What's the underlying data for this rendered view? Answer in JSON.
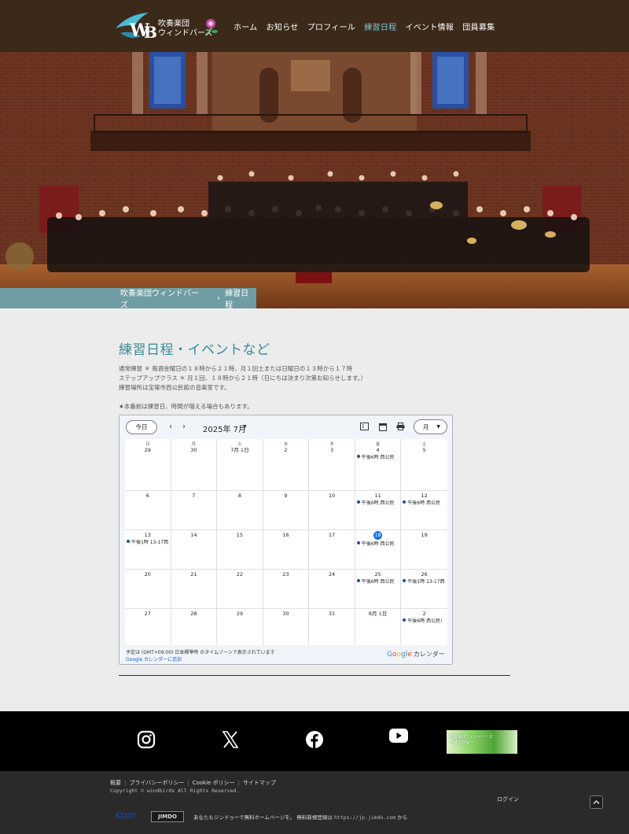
{
  "header": {
    "logo_line1": "吹奏楽団",
    "logo_line2": "ウィンドバーズ",
    "nav": [
      "ホーム",
      "お知らせ",
      "プロフィール",
      "練習日程",
      "イベント情報",
      "団員募集"
    ],
    "active_nav": "練習日程"
  },
  "breadcrumb": {
    "home": "吹奏楽団ウィンドバーズ",
    "separator": "›",
    "current": "練習日程"
  },
  "main": {
    "title": "練習日程・イベントなど",
    "lines": [
      "通常練習 ＊ 毎週金曜日の１８時から２１時、月１回土または日曜日の１３時から１７時",
      "ステップアップクラス ＊ 月１回、１８時から２１時（日にちは決まり次第お知らせします。）",
      "練習場所は宝塚市西公民館の音楽室です。"
    ],
    "note": "★本番前は練習日、時間が増える場合もあります。"
  },
  "calendar": {
    "today_button": "今日",
    "prev": "‹",
    "next": "›",
    "month_label": "2025年 7月",
    "view_button": "月",
    "weekdays": [
      "日",
      "月",
      "火",
      "水",
      "木",
      "金",
      "土"
    ],
    "weeks": [
      [
        {
          "d": "29"
        },
        {
          "d": "30"
        },
        {
          "d": "7月 1日"
        },
        {
          "d": "2"
        },
        {
          "d": "3"
        },
        {
          "d": "4",
          "ev": "午後6時 西公民"
        },
        {
          "d": "5"
        }
      ],
      [
        {
          "d": "6"
        },
        {
          "d": "7"
        },
        {
          "d": "8"
        },
        {
          "d": "9"
        },
        {
          "d": "10"
        },
        {
          "d": "11",
          "ev": "午後6時 西公民"
        },
        {
          "d": "12",
          "ev": "午後6時 西公民"
        }
      ],
      [
        {
          "d": "13",
          "ev": "午後1時 13-17西"
        },
        {
          "d": "14"
        },
        {
          "d": "15"
        },
        {
          "d": "16"
        },
        {
          "d": "17"
        },
        {
          "d": "18",
          "ev": "午後6時 西公民",
          "today": true
        },
        {
          "d": "19"
        }
      ],
      [
        {
          "d": "20"
        },
        {
          "d": "21"
        },
        {
          "d": "22"
        },
        {
          "d": "23"
        },
        {
          "d": "24"
        },
        {
          "d": "25",
          "ev": "午後6時 西公民"
        },
        {
          "d": "26",
          "ev": "午後1時 13-17西"
        }
      ],
      [
        {
          "d": "27"
        },
        {
          "d": "28"
        },
        {
          "d": "29"
        },
        {
          "d": "30"
        },
        {
          "d": "31"
        },
        {
          "d": "8月 1日"
        },
        {
          "d": "2",
          "ev": "午後6時 西公民!"
        }
      ]
    ],
    "timezone_note": "予定は (GMT+09:00) 日本標準時 のタイムゾーンで表示されています",
    "add_link": "Google カレンダーに追加",
    "brand_google": "Google",
    "brand_calendar": "カレンダー"
  },
  "banner": {
    "line1": "吹奏楽団ウィンドバーズ",
    "line2": "〜練習日程〜"
  },
  "footer": {
    "links": [
      "概要",
      "プライバシーポリシー",
      "Cookie ポリシー",
      "サイトマップ"
    ],
    "copyright": "Copyright © windbirds All Rights Reserved.",
    "login": "ログイン",
    "kddi": "KDDI",
    "jimdo": "JIMDO",
    "promo": "あなたもジンドゥーで無料ホームページを。 無料新規登録は",
    "promo_url": "https://jp.jimdo.com",
    "promo_suffix": "から"
  },
  "colors": {
    "header_bg": "#3b2a1a",
    "title": "#3c8a97",
    "active_nav": "#7fc5d6",
    "accent_blue": "#1a73e8"
  }
}
